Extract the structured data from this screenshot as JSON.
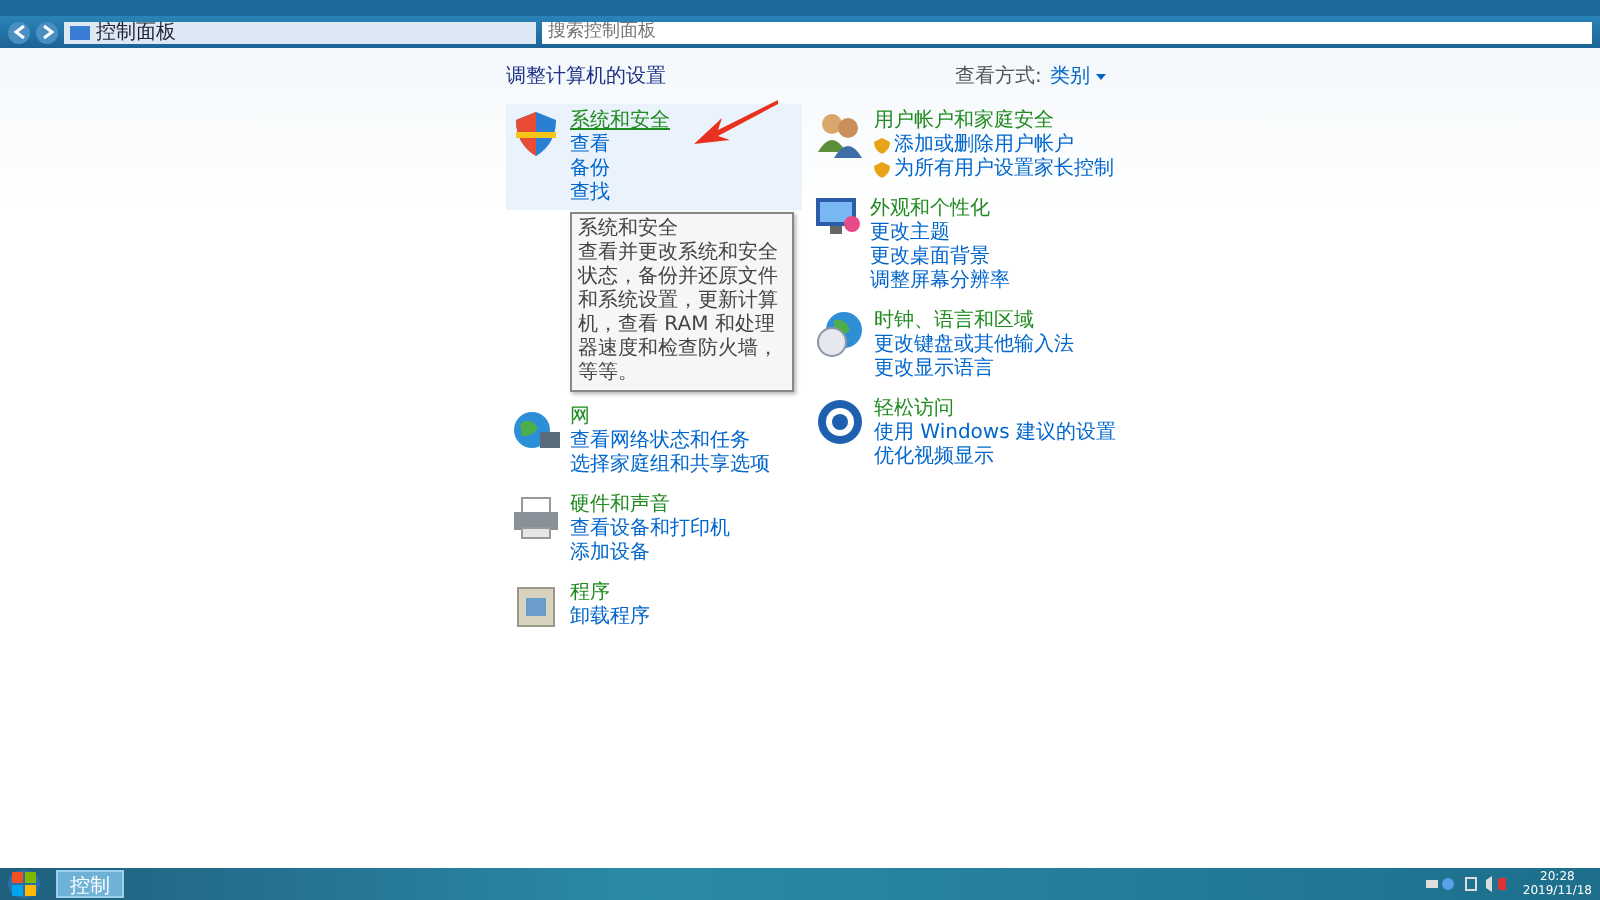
{
  "address_bar": {
    "breadcrumb": "控制面板",
    "search": {
      "placeholder": "搜索控制面板"
    }
  },
  "heading": "调整计算机的设置",
  "view_by": {
    "label": "查看方式:",
    "value": "类别"
  },
  "columns": [
    [
      {
        "kind": "shield",
        "title": "系统和安全",
        "selected": true,
        "links": [
          "查看",
          "备份",
          "查找"
        ]
      },
      {
        "kind": "globe",
        "title": "网",
        "selected": false,
        "links": [
          "查看网络状态和任务",
          "选择家庭组和共享选项"
        ]
      },
      {
        "kind": "printer",
        "title": "硬件和声音",
        "selected": false,
        "links": [
          "查看设备和打印机",
          "添加设备"
        ]
      },
      {
        "kind": "box",
        "title": "程序",
        "selected": false,
        "links": [
          "卸载程序"
        ]
      }
    ],
    [
      {
        "kind": "users",
        "title": "用户帐户和家庭安全",
        "selected": false,
        "links": [
          "添加或删除用户帐户",
          "为所有用户设置家长控制"
        ]
      },
      {
        "kind": "monitor",
        "title": "外观和个性化",
        "selected": false,
        "links": [
          "更改主题",
          "更改桌面背景",
          "调整屏幕分辨率"
        ]
      },
      {
        "kind": "clock",
        "title": "时钟、语言和区域",
        "selected": false,
        "links": [
          "更改键盘或其他输入法",
          "更改显示语言"
        ]
      },
      {
        "kind": "access",
        "title": "轻松访问",
        "selected": false,
        "links": [
          "使用 Windows 建议的设置",
          "优化视频显示"
        ]
      }
    ]
  ],
  "tooltip": {
    "title": "系统和安全",
    "text": "查看并更改系统和安全状态，备份并还原文件和系统设置，更新计算机，查看 RAM 和处理器速度和检查防火墙，等等。"
  },
  "taskbar": {
    "item": "控制",
    "time": "20:28",
    "date": "2019/11/18"
  }
}
